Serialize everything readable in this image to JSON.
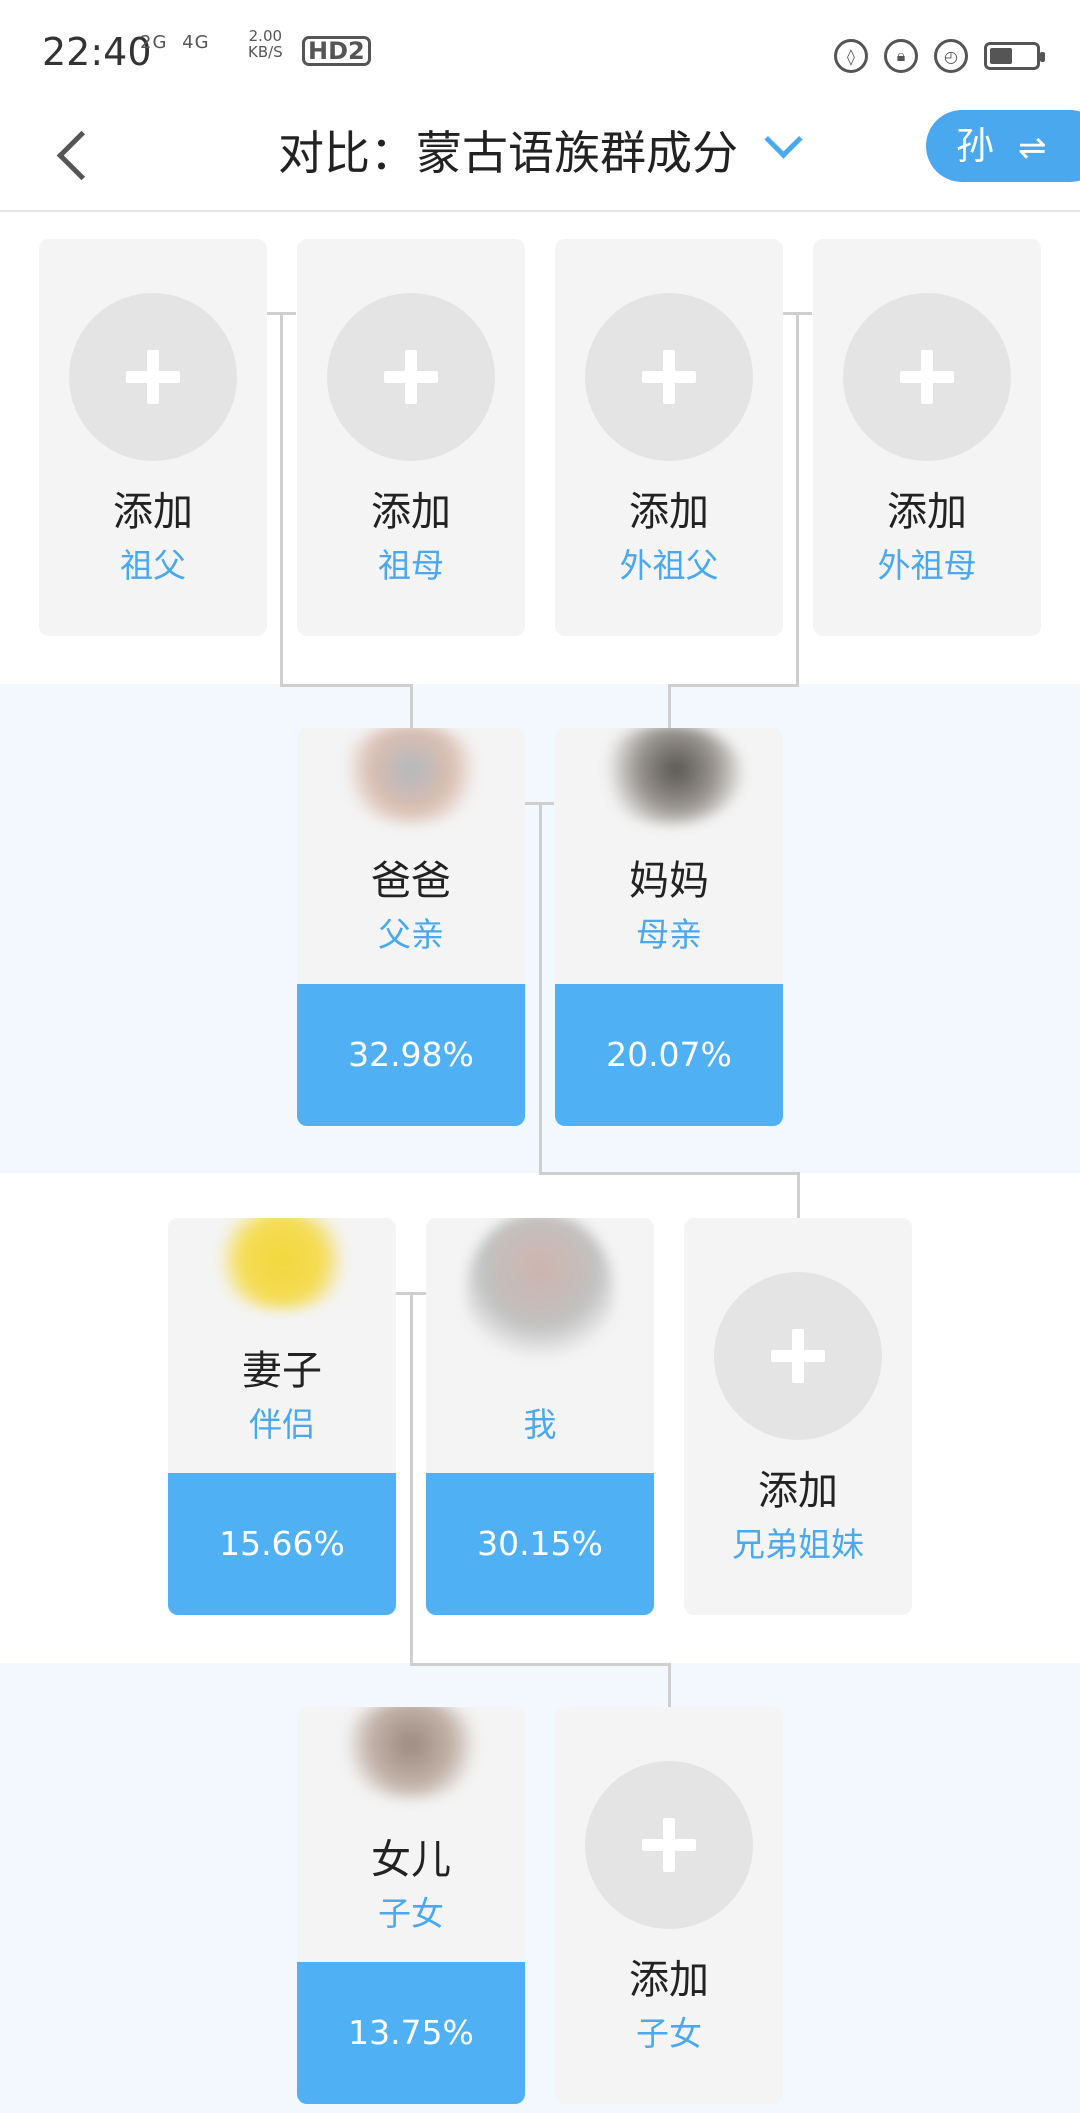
{
  "status": {
    "time": "22:40",
    "network": [
      "2G",
      "4G"
    ],
    "speed_value": "2.00",
    "speed_unit": "KB/S",
    "hd": "HD2"
  },
  "header": {
    "title": "对比：蒙古语族群成分",
    "switch_label": "孙",
    "switch_icon": "⇌"
  },
  "grandparents": [
    {
      "name": "添加",
      "relation": "祖父"
    },
    {
      "name": "添加",
      "relation": "祖母"
    },
    {
      "name": "添加",
      "relation": "外祖父"
    },
    {
      "name": "添加",
      "relation": "外祖母"
    }
  ],
  "parents": [
    {
      "name": "爸爸",
      "relation": "父亲",
      "percent": "32.98%"
    },
    {
      "name": "妈妈",
      "relation": "母亲",
      "percent": "20.07%"
    }
  ],
  "self_row": [
    {
      "name": "妻子",
      "relation": "伴侣",
      "percent": "15.66%"
    },
    {
      "name": "",
      "relation": "我",
      "percent": "30.15%"
    },
    {
      "name": "添加",
      "relation": "兄弟姐妹"
    }
  ],
  "children": [
    {
      "name": "女儿",
      "relation": "子女",
      "percent": "13.75%"
    },
    {
      "name": "添加",
      "relation": "子女"
    }
  ],
  "colors": {
    "accent": "#4aa8ee",
    "percent_bg": "#4fb1f4",
    "card_bg": "#f4f4f4",
    "band_bg": "#f2f8fd"
  }
}
